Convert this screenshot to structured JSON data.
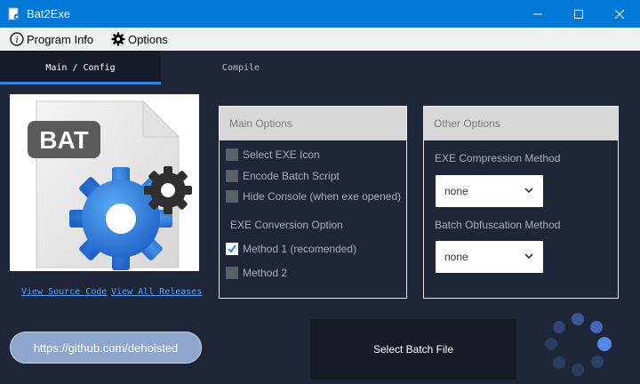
{
  "window": {
    "title": "Bat2Exe"
  },
  "menu": {
    "program_info": "Program Info",
    "options": "Options"
  },
  "tabs": [
    {
      "label": "Main / Config",
      "active": true
    },
    {
      "label": "Compile",
      "active": false
    }
  ],
  "image": {
    "badge_text": "BAT"
  },
  "links": {
    "source": "View Source Code",
    "releases": "View All Releases"
  },
  "main_options": {
    "header": "Main Options",
    "checkboxes": [
      {
        "label": "Select EXE Icon",
        "checked": false
      },
      {
        "label": "Encode Batch Script",
        "checked": false
      },
      {
        "label": "Hide Console (when exe opened)",
        "checked": false
      }
    ],
    "conversion_header": "EXE Conversion Option",
    "methods": [
      {
        "label": "Method 1 (recomended)",
        "checked": true
      },
      {
        "label": "Method 2",
        "checked": false
      }
    ]
  },
  "other_options": {
    "header": "Other Options",
    "compression_label": "EXE Compression Method",
    "compression_value": "none",
    "obfuscation_label": "Batch Obfuscation Method",
    "obfuscation_value": "none"
  },
  "footer": {
    "url": "https://github.com/dehoisted",
    "select_batch": "Select Batch File"
  },
  "colors": {
    "titlebar": "#0078d7",
    "background": "#1f2638",
    "accent": "#2e85e5",
    "spinner": "#4f7fe0"
  }
}
